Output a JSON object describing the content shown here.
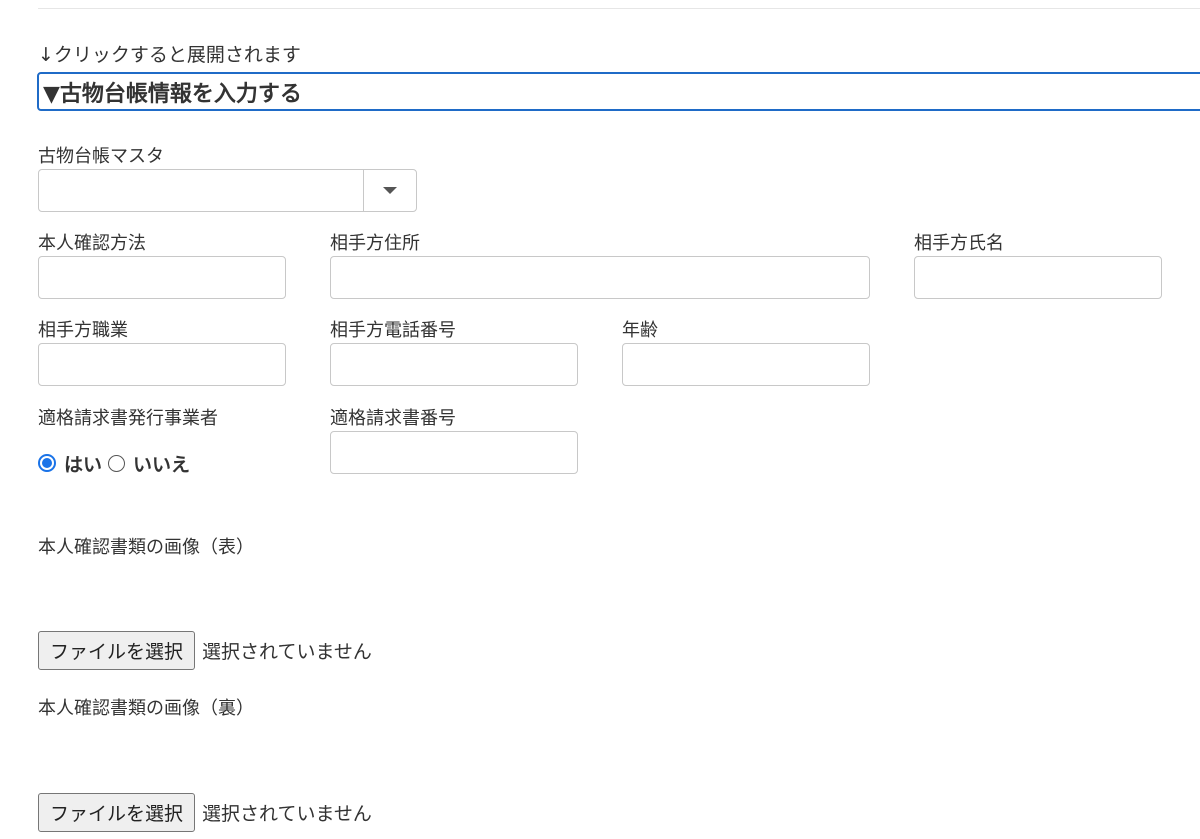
{
  "hint_text": "↓クリックすると展開されます",
  "section_toggle": "▼古物台帳情報を入力する",
  "ledger_master": {
    "label": "古物台帳マスタ",
    "value": ""
  },
  "fields": {
    "id_method": {
      "label": "本人確認方法",
      "value": ""
    },
    "partner_address": {
      "label": "相手方住所",
      "value": ""
    },
    "partner_name": {
      "label": "相手方氏名",
      "value": ""
    },
    "partner_occupation": {
      "label": "相手方職業",
      "value": ""
    },
    "partner_phone": {
      "label": "相手方電話番号",
      "value": ""
    },
    "age": {
      "label": "年齢",
      "value": ""
    },
    "invoice_number": {
      "label": "適格請求書番号",
      "value": ""
    }
  },
  "qualified_issuer": {
    "label": "適格請求書発行事業者",
    "options": [
      "はい",
      "いいえ"
    ],
    "selected": "はい"
  },
  "id_image_front": {
    "label": "本人確認書類の画像（表）",
    "button_label": "ファイルを選択",
    "status": "選択されていません"
  },
  "id_image_back": {
    "label": "本人確認書類の画像（裏）",
    "button_label": "ファイルを選択",
    "status": "選択されていません"
  },
  "colors": {
    "accent": "#1f6bc7",
    "radio_checked": "#1a73e8",
    "input_border": "#c8c8c8"
  },
  "icons": {
    "select_toggle": "caret-down-icon"
  }
}
